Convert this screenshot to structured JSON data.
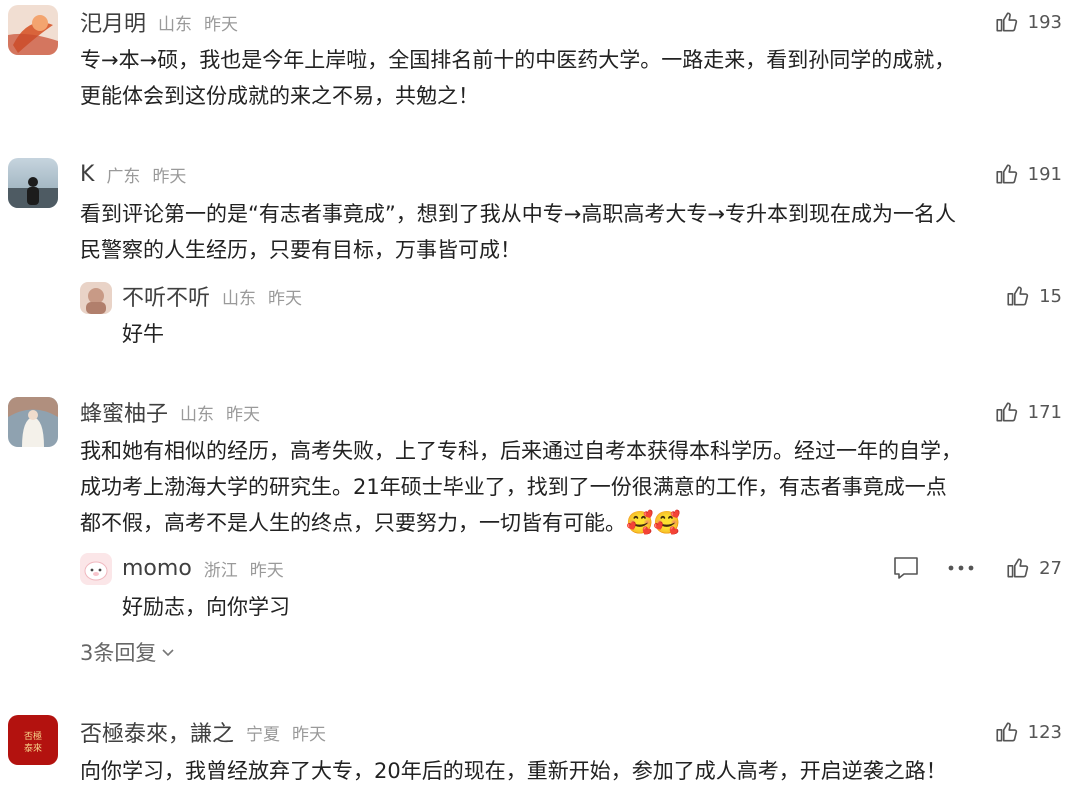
{
  "comments": [
    {
      "name": "汜月明",
      "location": "山东",
      "time": "昨天",
      "likes": "193",
      "text_lines": [
        "专→本→硕，我也是今年上岸啦，全国排名前十的中医药大学。一路走来，看到孙同学的成就，",
        "更能体会到这份成就的来之不易，共勉之！"
      ]
    },
    {
      "name": "K",
      "location": "广东",
      "time": "昨天",
      "likes": "191",
      "text_lines": [
        "看到评论第一的是“有志者事竟成”，想到了我从中专→高职高考大专→专升本到现在成为一名人",
        "民警察的人生经历，只要有目标，万事皆可成！"
      ],
      "reply": {
        "name": "不听不听",
        "location": "山东",
        "time": "昨天",
        "likes": "15",
        "text": "好牛"
      }
    },
    {
      "name": "蜂蜜柚子",
      "location": "山东",
      "time": "昨天",
      "likes": "171",
      "text_lines": [
        "我和她有相似的经历，高考失败，上了专科，后来通过自考本获得本科学历。经过一年的自学，",
        "成功考上渤海大学的研究生。21年硕士毕业了，找到了一份很满意的工作，有志者事竟成一点",
        "都不假，高考不是人生的终点，只要努力，一切皆有可能。"
      ],
      "emoji": "🥰🥰",
      "reply": {
        "name": "momo",
        "location": "浙江",
        "time": "昨天",
        "likes": "27",
        "text": "好励志，向你学习"
      },
      "more_replies": "3条回复"
    },
    {
      "name": "否極泰來，謙之",
      "location": "宁夏",
      "time": "昨天",
      "likes": "123",
      "text_lines": [
        "向你学习，我曾经放弃了大专，20年后的现在，重新开始，参加了成人高考，开启逆袭之路！"
      ]
    }
  ]
}
